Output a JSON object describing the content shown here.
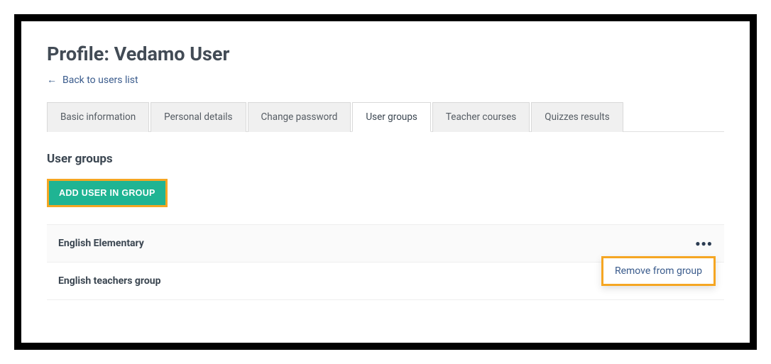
{
  "page": {
    "title": "Profile: Vedamo User",
    "back_label": "Back to users list"
  },
  "tabs": [
    {
      "label": "Basic information",
      "active": false
    },
    {
      "label": "Personal details",
      "active": false
    },
    {
      "label": "Change password",
      "active": false
    },
    {
      "label": "User groups",
      "active": true
    },
    {
      "label": "Teacher courses",
      "active": false
    },
    {
      "label": "Quizzes results",
      "active": false
    }
  ],
  "section": {
    "title": "User groups",
    "add_button_label": "ADD USER IN GROUP"
  },
  "groups": [
    {
      "name": "English Elementary"
    },
    {
      "name": "English teachers group"
    }
  ],
  "dropdown": {
    "remove_label": "Remove from group"
  }
}
